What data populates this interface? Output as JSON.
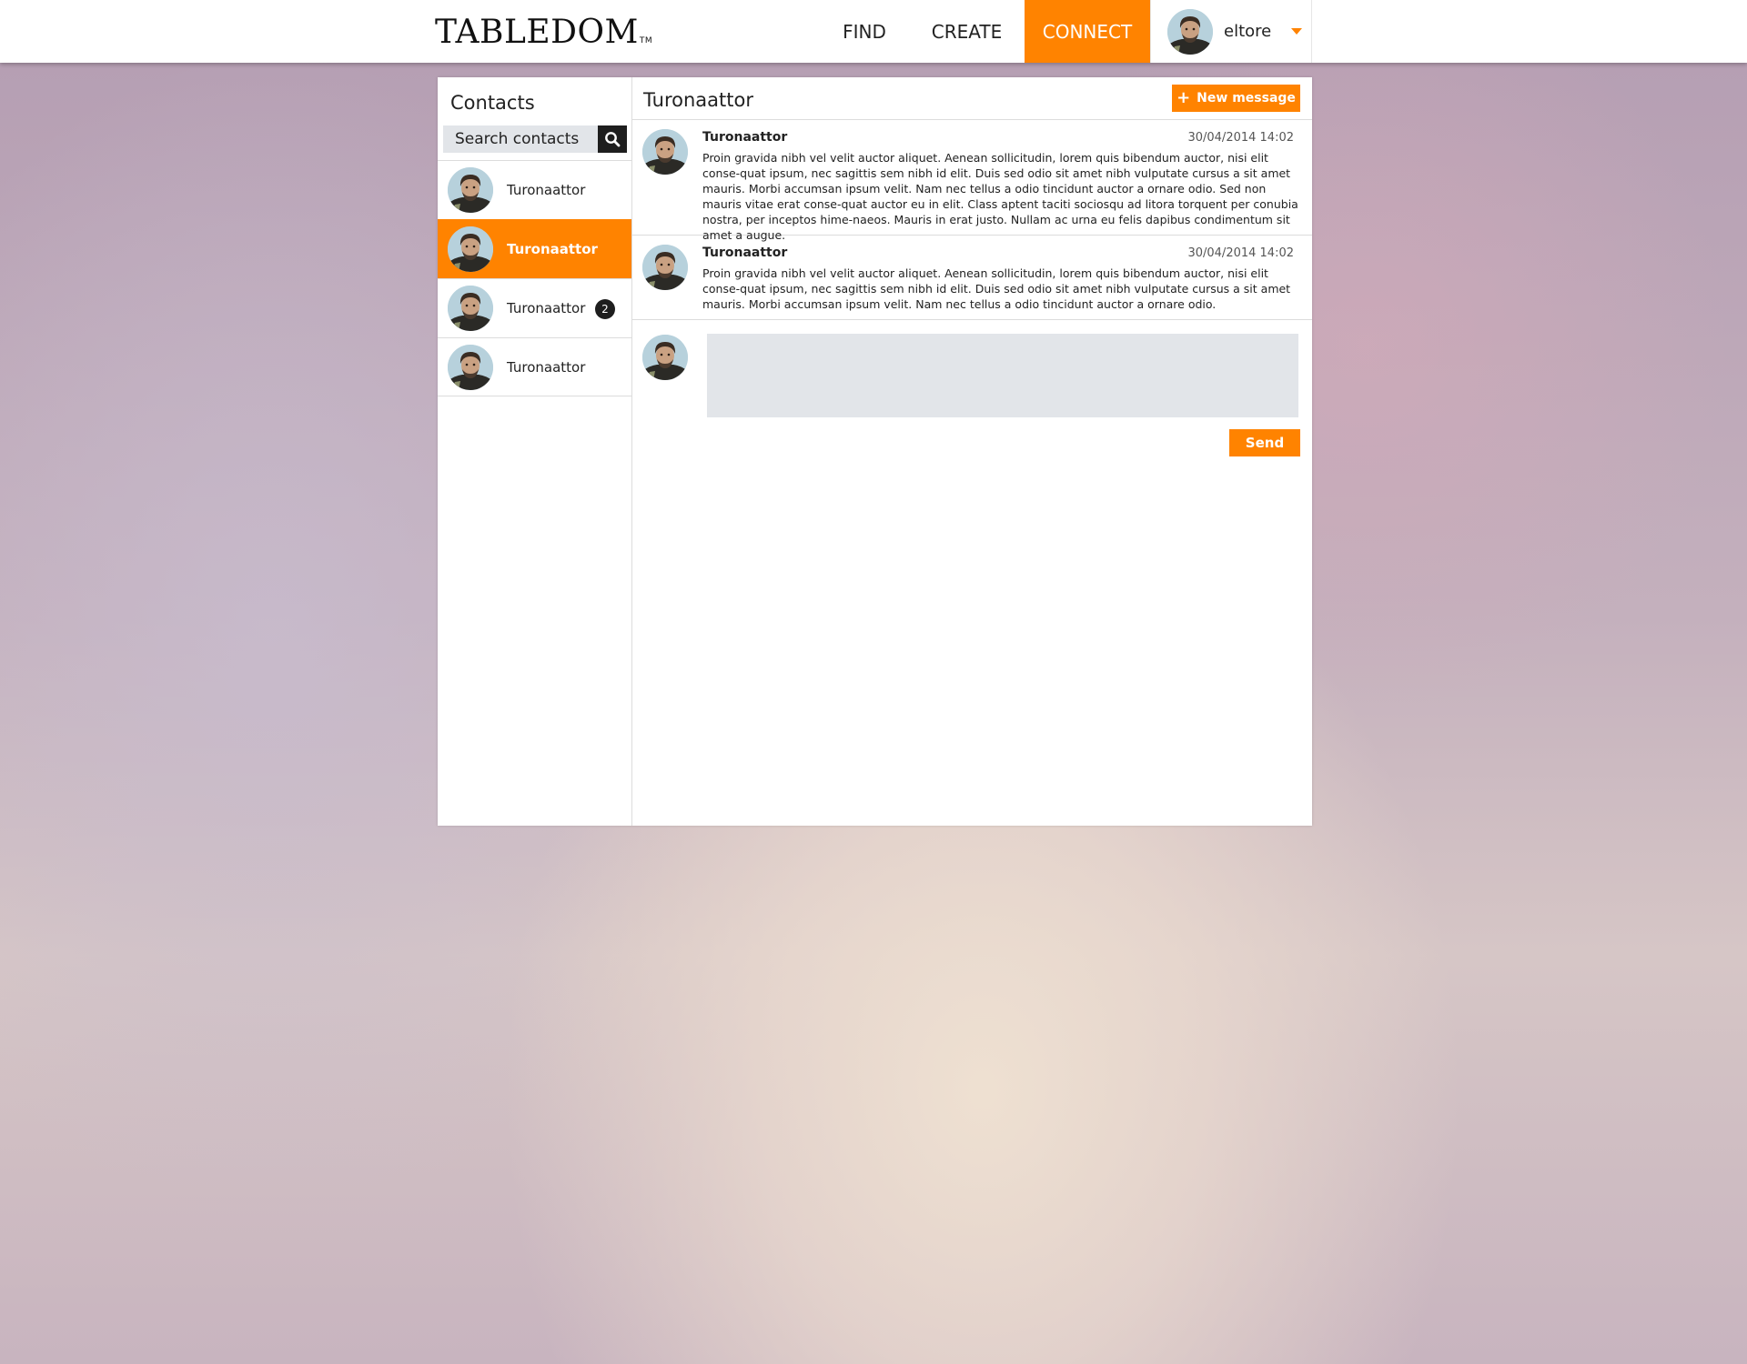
{
  "brand": {
    "logo_text": "TABLEDOM",
    "logo_tm": "TM",
    "accent_color": "#ff8300"
  },
  "nav": {
    "find": "FIND",
    "create": "CREATE",
    "connect": "CONNECT",
    "active": "connect"
  },
  "user": {
    "name": "eltore",
    "avatar_icon": "user-avatar"
  },
  "contacts": {
    "title": "Contacts",
    "search_placeholder": "Search contacts",
    "items": [
      {
        "name": "Turonaattor",
        "active": false,
        "badge": ""
      },
      {
        "name": "Turonaattor",
        "active": true,
        "badge": ""
      },
      {
        "name": "Turonaattor",
        "active": false,
        "badge": "2"
      },
      {
        "name": "Turonaattor",
        "active": false,
        "badge": ""
      }
    ]
  },
  "conversation": {
    "title": "Turonaattor",
    "new_message_label": "New message",
    "new_message_icon": "plus-icon",
    "messages": [
      {
        "author": "Turonaattor",
        "time": "30/04/2014 14:02",
        "body": "Proin gravida nibh vel velit auctor aliquet. Aenean sollicitudin, lorem quis bibendum auctor, nisi elit conse-quat ipsum, nec sagittis sem nibh id elit. Duis sed odio sit amet nibh vulputate cursus a sit amet mauris. Morbi accumsan ipsum velit. Nam nec tellus a odio tincidunt auctor a ornare odio. Sed non  mauris vitae erat conse-quat auctor eu in elit. Class aptent taciti sociosqu ad litora torquent per conubia nostra, per inceptos hime-naeos. Mauris in erat justo. Nullam ac urna eu felis dapibus condimentum sit amet a augue."
      },
      {
        "author": "Turonaattor",
        "time": "30/04/2014 14:02",
        "body": "Proin gravida nibh vel velit auctor aliquet. Aenean sollicitudin, lorem quis bibendum auctor, nisi elit conse-quat ipsum, nec sagittis sem nibh id elit. Duis sed odio sit amet nibh vulputate cursus a sit amet mauris. Morbi accumsan ipsum velit. Nam nec tellus a odio tincidunt auctor a ornare odio."
      }
    ],
    "reply_value": "",
    "send_label": "Send"
  }
}
